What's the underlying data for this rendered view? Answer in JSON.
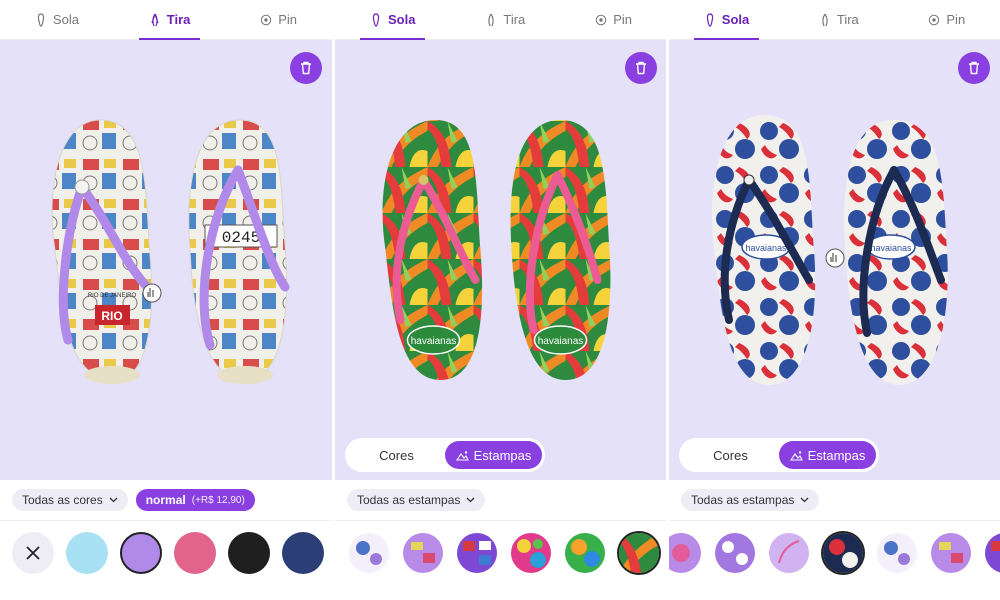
{
  "colors": {
    "accent": "#8a3fe0",
    "stage_bg": "#e4e1f9",
    "chip_bg": "#eeedf6"
  },
  "panels": [
    {
      "tabs": [
        {
          "label": "Sola",
          "icon": "sole-icon",
          "active": false
        },
        {
          "label": "Tira",
          "icon": "strap-icon",
          "active": true
        },
        {
          "label": "Pin",
          "icon": "pin-icon",
          "active": false
        }
      ],
      "filters": [
        {
          "label": "Todas as cores",
          "selected": false
        },
        {
          "label": "normal",
          "extra": "(+R$ 12,90)",
          "selected": true
        }
      ],
      "swatches": [
        "#a8e0f4",
        "#b189e8",
        "#e0648c",
        "#1f1f1f",
        "#2c3e76"
      ],
      "selected_swatch": 1
    },
    {
      "tabs": [
        {
          "label": "Sola",
          "icon": "sole-icon",
          "active": true
        },
        {
          "label": "Tira",
          "icon": "strap-icon",
          "active": false
        },
        {
          "label": "Pin",
          "icon": "pin-icon",
          "active": false
        }
      ],
      "toggle": {
        "left": "Cores",
        "right": "Estampas",
        "selected": "right"
      },
      "filter": {
        "label": "Todas as estampas"
      },
      "print_swatches": 6
    },
    {
      "tabs": [
        {
          "label": "Sola",
          "icon": "sole-icon",
          "active": true
        },
        {
          "label": "Tira",
          "icon": "strap-icon",
          "active": false
        },
        {
          "label": "Pin",
          "icon": "pin-icon",
          "active": false
        }
      ],
      "toggle": {
        "left": "Cores",
        "right": "Estampas",
        "selected": "right"
      },
      "filter": {
        "label": "Todas as estampas"
      },
      "print_swatches": 8
    }
  ],
  "brand_logo": "havaianas",
  "postcard_text": [
    "RIO",
    "0245",
    "RIO DE JANEIRO"
  ]
}
